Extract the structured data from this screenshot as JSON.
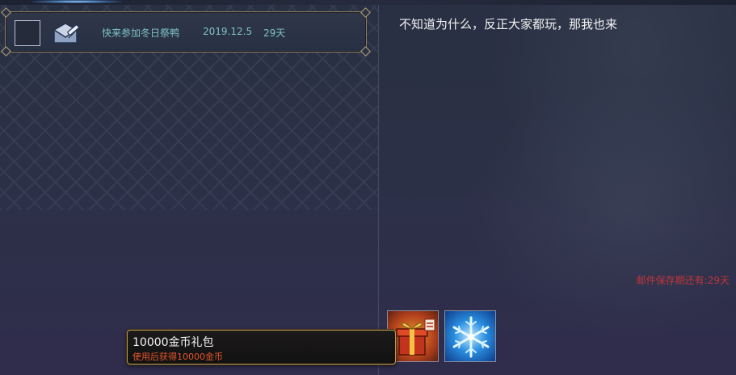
{
  "mail_list": {
    "items": [
      {
        "subject": "快来参加冬日祭鸭",
        "date": "2019.12.5",
        "days_left": "29天",
        "icon": "mail-letter-icon"
      }
    ]
  },
  "mail_detail": {
    "body": "不知道为什么，反正大家都玩，那我也来",
    "expiry": "邮件保存期还有:29天",
    "attachments": [
      {
        "name": "gift-box-icon"
      },
      {
        "name": "snowflake-icon"
      }
    ]
  },
  "tooltip": {
    "title": "10000金币礼包",
    "description": "使用后获得10000金币"
  },
  "colors": {
    "accent_text": "#7fc3c9",
    "expiry_red": "#c2353a",
    "tooltip_desc": "#e3562b",
    "gold_border": "#c19a4e"
  }
}
